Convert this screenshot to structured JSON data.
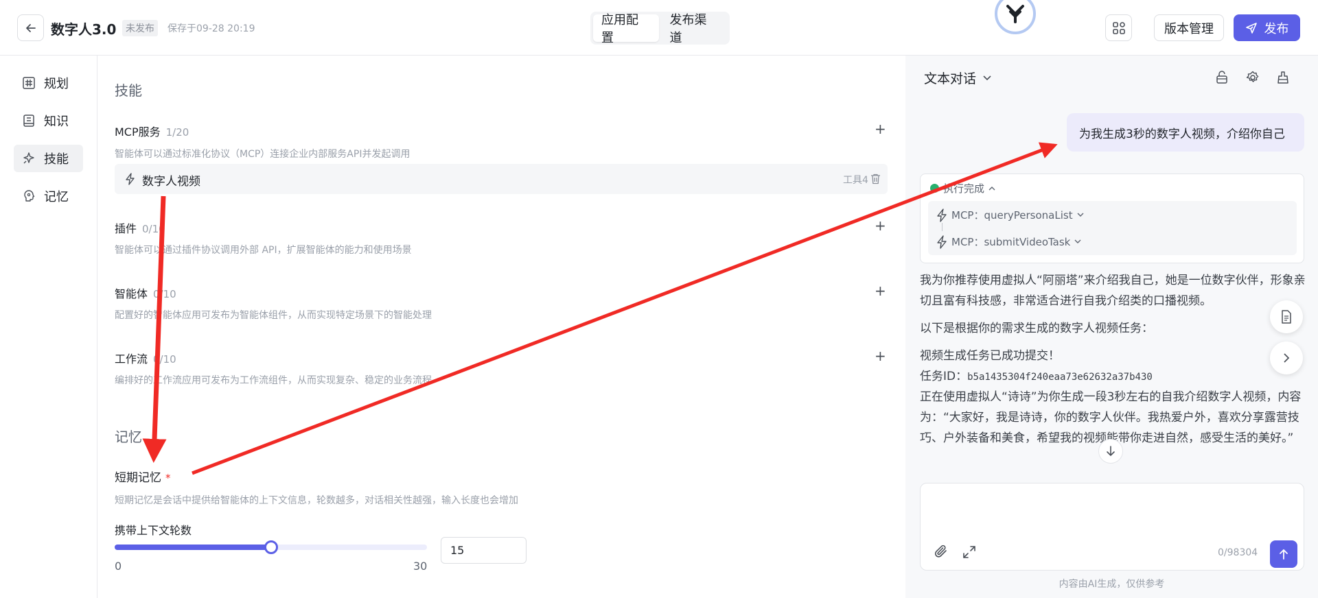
{
  "header": {
    "app_title": "数字人3.0",
    "status": "未发布",
    "save_time": "保存于09-28 20:19",
    "tabs": [
      {
        "label": "应用配置",
        "active": true
      },
      {
        "label": "发布渠道",
        "active": false
      }
    ],
    "version_label": "版本管理",
    "publish_label": "发布"
  },
  "sidebar": {
    "items": [
      {
        "label": "规划",
        "icon": "hash-icon"
      },
      {
        "label": "知识",
        "icon": "book-icon"
      },
      {
        "label": "技能",
        "icon": "sparkle-icon",
        "active": true
      },
      {
        "label": "记忆",
        "icon": "brain-icon"
      }
    ]
  },
  "skills": {
    "section_title": "技能",
    "mcp": {
      "title": "MCP服务",
      "count": "1/20",
      "desc": "智能体可以通过标准化协议（MCP）连接企业内部服务API并发起调用",
      "item_name": "数字人视频",
      "item_tool": "工具4"
    },
    "plugin": {
      "title": "插件",
      "count": "0/10",
      "desc": "智能体可以通过插件协议调用外部 API，扩展智能体的能力和使用场景"
    },
    "agent": {
      "title": "智能体",
      "count": "0/10",
      "desc": "配置好的智能体应用可发布为智能体组件，从而实现特定场景下的智能处理"
    },
    "workflow": {
      "title": "工作流",
      "count": "0/10",
      "desc": "编排好的工作流应用可发布为工作流组件，从而实现复杂、稳定的业务流程"
    }
  },
  "memory": {
    "section_title": "记忆",
    "short_title": "短期记忆",
    "required_mark": "*",
    "short_desc": "短期记忆是会话中提供给智能体的上下文信息，轮数越多，对话相关性越强，输入长度也会增加",
    "rounds_label": "携带上下文轮数",
    "slider_value": 15,
    "slider_min": 0,
    "slider_max": 30,
    "min_label": "0",
    "max_label": "30",
    "value_text": "15"
  },
  "chat": {
    "mode_label": "文本对话",
    "user_message": "为我生成3秒的数字人视频，介绍你自己",
    "exec_status": "执行完成",
    "calls": [
      {
        "label": "MCP：queryPersonaList"
      },
      {
        "label": "MCP：submitVideoTask"
      }
    ],
    "answer": {
      "p1": "我为你推荐使用虚拟人“阿丽塔”来介绍我自己，她是一位数字伙伴，形象亲切且富有科技感，非常适合进行自我介绍类的口播视频。",
      "p2": "以下是根据你的需求生成的数字人视频任务：",
      "p3": "视频生成任务已成功提交！",
      "task_label": "任务ID：",
      "task_id": "b5a1435304f240eaa73e62632a37b430",
      "p4": "正在使用虚拟人“诗诗”为你生成一段3秒左右的自我介绍数字人视频，内容为：“大家好，我是诗诗，你的数字人伙伴。我热爱户外，喜欢分享露营技巧、户外装备和美食，希望我的视频能带你走进自然，感受生活的美好。”"
    },
    "input_placeholder": "",
    "char_count": "0/98304",
    "disclaimer": "内容由AI生成，仅供参考"
  },
  "colors": {
    "accent": "#5b5fe6",
    "success": "#27b06e",
    "annotation": "#f02a25"
  }
}
